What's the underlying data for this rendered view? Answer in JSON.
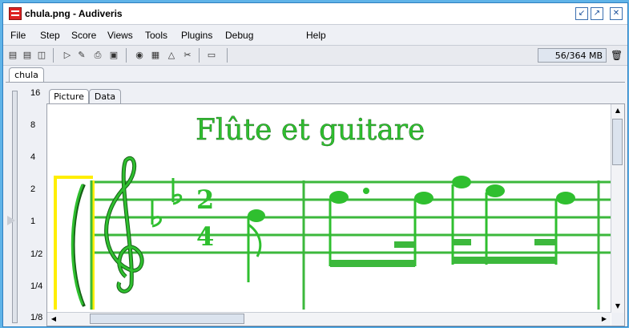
{
  "window": {
    "title": "chula.png - Audiveris"
  },
  "menu": [
    "File",
    "Step",
    "Score",
    "Views",
    "Tools",
    "Plugins",
    "Debug",
    "Help"
  ],
  "toolbar": {
    "icons": [
      "open-icon",
      "columns-icon",
      "rows-icon",
      "play-step-icon",
      "edit-icon",
      "print-icon",
      "save-icon",
      "binoculars-icon",
      "book-icon",
      "triangle-icon",
      "scissors-icon",
      "midi-icon"
    ],
    "memory": "56/364 MB"
  },
  "sheet_tab": "chula",
  "zoom_labels": [
    "16",
    "8",
    "4",
    "2",
    "1",
    "1/2",
    "1/4",
    "1/8"
  ],
  "view_tabs": [
    "Picture",
    "Data"
  ],
  "score": {
    "title": "Flûte  et  guitare"
  },
  "colors": {
    "glyph": "#2fbf2f",
    "staff": "#3cb83c",
    "system": "#ffee00"
  }
}
